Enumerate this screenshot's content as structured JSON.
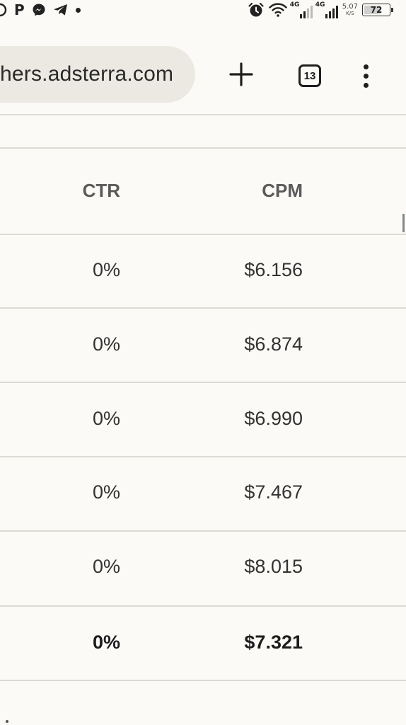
{
  "status_bar": {
    "left_icons": [
      "circle-icon",
      "pinterest-icon",
      "messenger-icon",
      "telegram-icon",
      "notification-dot-icon"
    ],
    "pinterest_glyph": "P",
    "network_1_label": "4G",
    "network_2_label": "4G",
    "speed_value": "5.07",
    "speed_unit": "K/S",
    "battery_level": "72",
    "battery_fraction": 0.72
  },
  "browser": {
    "url": "hers.adsterra.com",
    "tab_count": "13",
    "new_tab_icon": "plus-icon",
    "menu_icon": "more-vert-icon"
  },
  "table": {
    "columns": {
      "ctr": "CTR",
      "cpm": "CPM"
    },
    "rows": [
      {
        "ctr": "0%",
        "cpm": "$6.156"
      },
      {
        "ctr": "0%",
        "cpm": "$6.874"
      },
      {
        "ctr": "0%",
        "cpm": "$6.990"
      },
      {
        "ctr": "0%",
        "cpm": "$7.467"
      },
      {
        "ctr": "0%",
        "cpm": "$8.015"
      }
    ],
    "total": {
      "ctr": "0%",
      "cpm": "$7.321"
    }
  },
  "colors": {
    "background": "#fbfaf6",
    "url_pill": "#ebe9e2",
    "divider": "#dcdad4",
    "text": "#333333"
  }
}
